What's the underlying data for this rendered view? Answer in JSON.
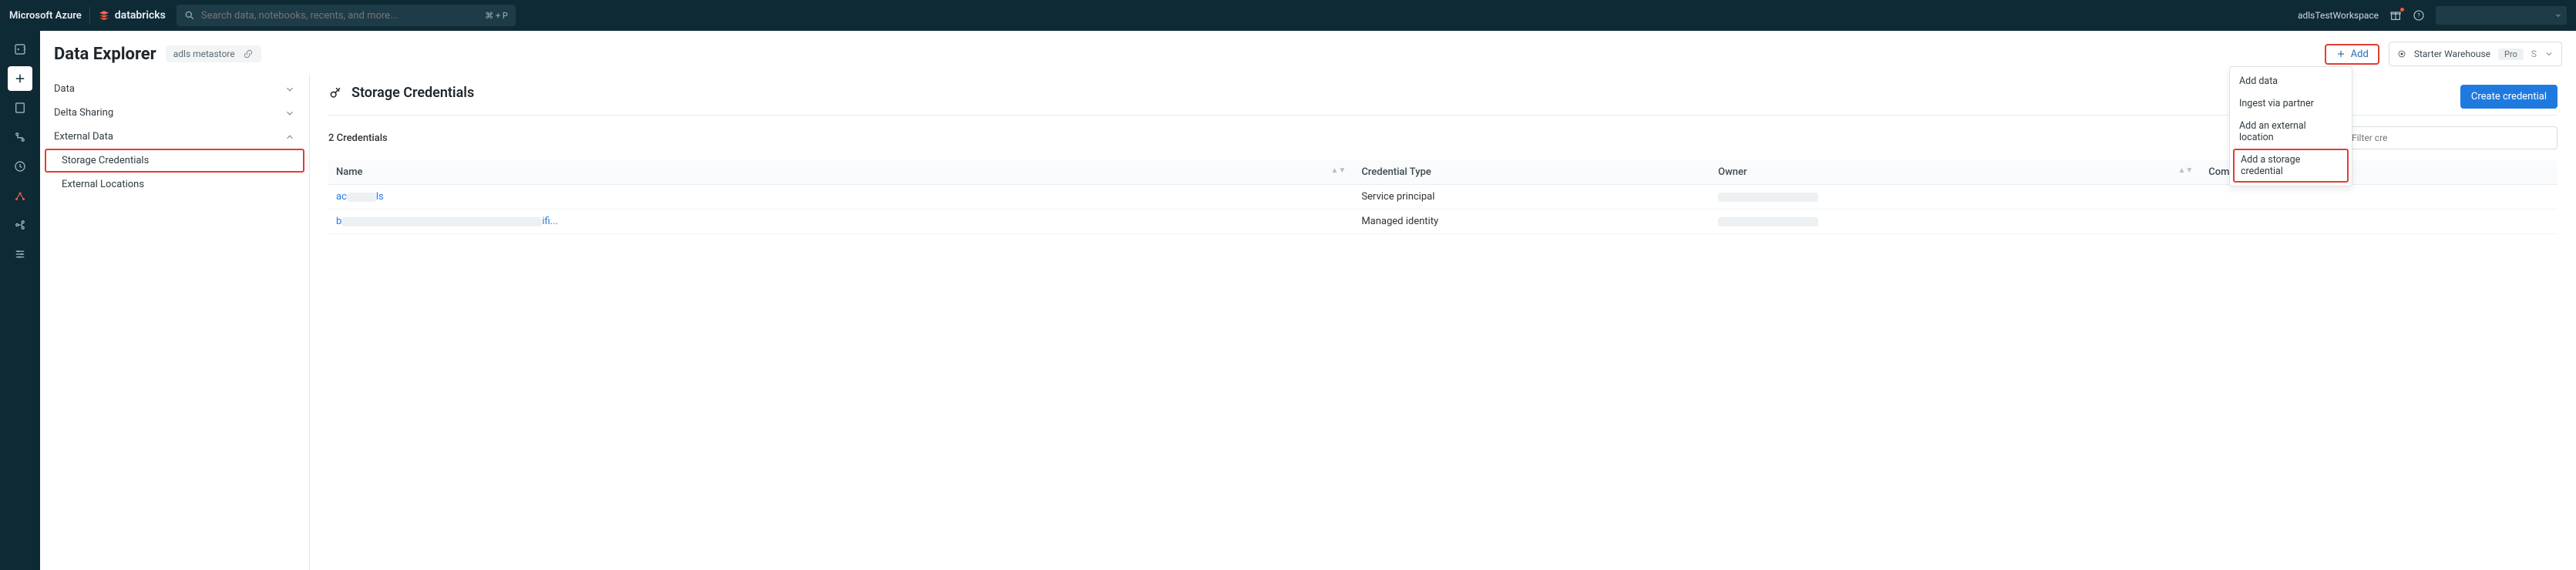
{
  "topbar": {
    "brand_azure": "Microsoft Azure",
    "brand_db": "databricks",
    "search_placeholder": "Search data, notebooks, recents, and more...",
    "search_shortcut": "⌘ + P",
    "workspace_name": "adlsTestWorkspace"
  },
  "page": {
    "title": "Data Explorer",
    "metastore": "adls metastore",
    "add_label": "Add",
    "starter_warehouse": "Starter Warehouse",
    "starter_tier": "Pro",
    "starter_size": "S"
  },
  "tree": {
    "data": "Data",
    "delta_sharing": "Delta Sharing",
    "external_data": "External Data",
    "storage_credentials": "Storage Credentials",
    "external_locations": "External Locations"
  },
  "content": {
    "heading": "Storage Credentials",
    "create_button": "Create credential",
    "count_label": "2 Credentials",
    "filter_placeholder": "Filter cre",
    "columns": {
      "name": "Name",
      "credential_type": "Credential Type",
      "owner": "Owner",
      "comment": "Comment"
    },
    "rows": [
      {
        "name_prefix": "ac",
        "name_suffix": "ls",
        "credential_type": "Service principal"
      },
      {
        "name_prefix": "b",
        "name_suffix": "ifi...",
        "credential_type": "Managed identity"
      }
    ]
  },
  "add_menu": {
    "items": [
      "Add data",
      "Ingest via partner",
      "Add an external location",
      "Add a storage credential"
    ],
    "highlight_index": 3
  }
}
